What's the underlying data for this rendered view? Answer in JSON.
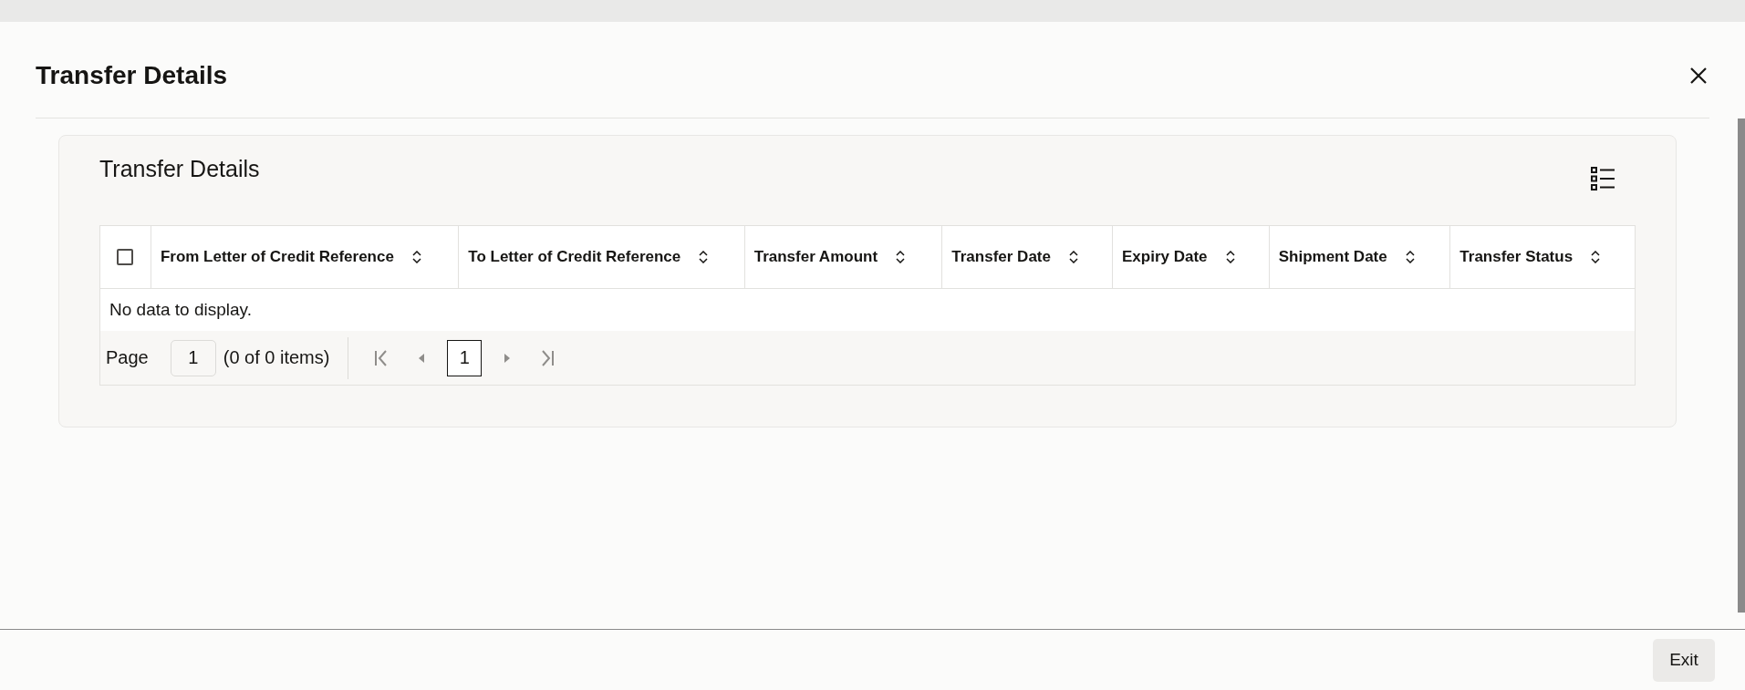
{
  "dialog": {
    "title": "Transfer Details"
  },
  "panel": {
    "title": "Transfer Details"
  },
  "table": {
    "select_all": {
      "checked": false
    },
    "columns": [
      {
        "label": "From Letter of Credit Reference"
      },
      {
        "label": "To Letter of Credit Reference"
      },
      {
        "label": "Transfer Amount"
      },
      {
        "label": "Transfer Date"
      },
      {
        "label": "Expiry Date"
      },
      {
        "label": "Shipment Date"
      },
      {
        "label": "Transfer Status"
      }
    ],
    "empty_message": "No data to display."
  },
  "pagination": {
    "page_label": "Page",
    "page_input": "1",
    "summary": "(0 of 0 items)",
    "pages": [
      {
        "label": "1",
        "selected": true
      }
    ]
  },
  "footer": {
    "buttons": [
      "Exit"
    ]
  }
}
